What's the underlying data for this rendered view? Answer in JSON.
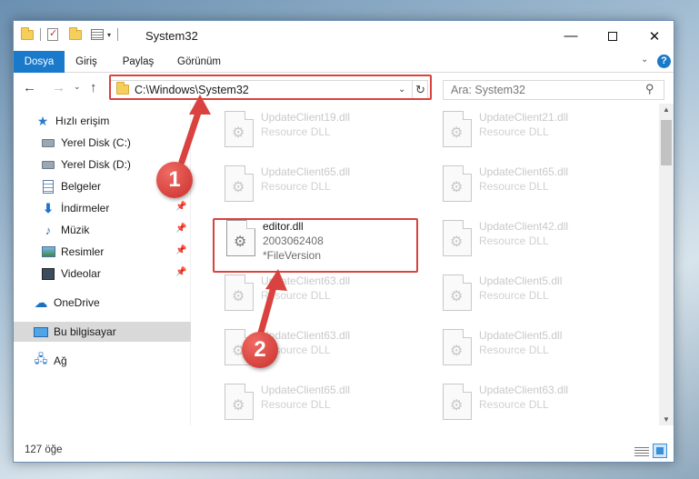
{
  "window": {
    "title": "System32",
    "quick_access_dropdown": "▾"
  },
  "ribbon": {
    "file_tab": "Dosya",
    "tabs": [
      "Giriş",
      "Paylaş",
      "Görünüm"
    ]
  },
  "nav": {
    "address_path": "C:\\Windows\\System32",
    "search_placeholder": "Ara: System32"
  },
  "sidebar": {
    "items": [
      {
        "label": "Hızlı erişim",
        "icon": "star-icon"
      },
      {
        "label": "Yerel Disk (C:)",
        "icon": "drive-icon"
      },
      {
        "label": "Yerel Disk (D:)",
        "icon": "drive-icon"
      },
      {
        "label": "Belgeler",
        "icon": "documents-icon"
      },
      {
        "label": "İndirmeler",
        "icon": "downloads-icon"
      },
      {
        "label": "Müzik",
        "icon": "music-icon"
      },
      {
        "label": "Resimler",
        "icon": "pictures-icon"
      },
      {
        "label": "Videolar",
        "icon": "videos-icon"
      },
      {
        "label": "OneDrive",
        "icon": "cloud-icon"
      },
      {
        "label": "Bu bilgisayar",
        "icon": "computer-icon"
      },
      {
        "label": "Ağ",
        "icon": "network-icon"
      }
    ]
  },
  "files": {
    "left_column": [
      {
        "name": "UpdateClient19.dll",
        "type": "Resource DLL"
      },
      {
        "name": "UpdateClient65.dll",
        "type": "Resource DLL"
      },
      {
        "name": "UpdateClient63.dll",
        "type": "Resource DLL"
      },
      {
        "name": "UpdateClient63.dll",
        "type": "Resource DLL"
      },
      {
        "name": "UpdateClient65.dll",
        "type": "Resource DLL"
      }
    ],
    "right_column": [
      {
        "name": "UpdateClient21.dll",
        "type": "Resource DLL"
      },
      {
        "name": "UpdateClient65.dll",
        "type": "Resource DLL"
      },
      {
        "name": "UpdateClient42.dll",
        "type": "Resource DLL"
      },
      {
        "name": "UpdateClient5.dll",
        "type": "Resource DLL"
      },
      {
        "name": "UpdateClient5.dll",
        "type": "Resource DLL"
      },
      {
        "name": "UpdateClient63.dll",
        "type": "Resource DLL"
      }
    ],
    "highlighted": {
      "name": "editor.dll",
      "size": "2003062408",
      "version": "*FileVersion"
    }
  },
  "status": {
    "item_count": "127 öğe"
  },
  "callouts": {
    "step1": "1",
    "step2": "2",
    "color": "#d9423f"
  }
}
